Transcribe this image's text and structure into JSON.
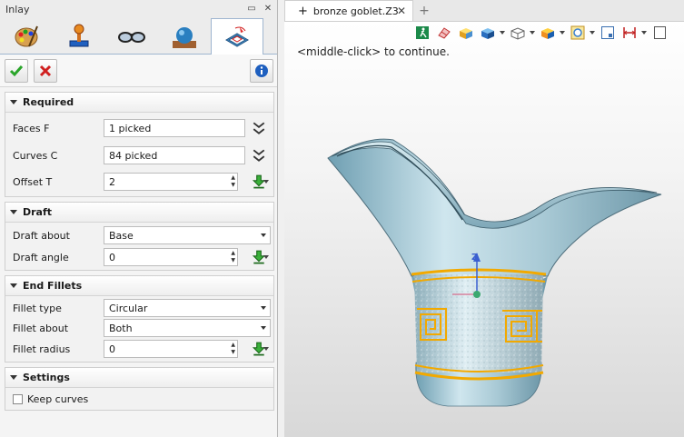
{
  "panel": {
    "title": "Inlay",
    "tabs": [
      {
        "icon": "paint-palette-icon"
      },
      {
        "icon": "joystick-icon"
      },
      {
        "icon": "glasses-icon"
      },
      {
        "icon": "sphere-icon"
      },
      {
        "icon": "inlay-tool-icon"
      }
    ]
  },
  "required": {
    "title": "Required",
    "faces_label": "Faces F",
    "faces_value": "1 picked",
    "curves_label": "Curves C",
    "curves_value": "84 picked",
    "offset_label": "Offset T",
    "offset_value": "2"
  },
  "draft": {
    "title": "Draft",
    "about_label": "Draft about",
    "about_value": "Base",
    "angle_label": "Draft angle",
    "angle_value": "0"
  },
  "fillets": {
    "title": "End Fillets",
    "type_label": "Fillet type",
    "type_value": "Circular",
    "about_label": "Fillet about",
    "about_value": "Both",
    "radius_label": "Fillet radius",
    "radius_value": "0"
  },
  "settings": {
    "title": "Settings",
    "keep_curves_label": "Keep curves"
  },
  "document": {
    "tab_label": "bronze goblet.Z3",
    "hint": "<middle-click> to continue."
  },
  "axis": {
    "z_label": "Z"
  },
  "colors": {
    "goblet": "#a9c9d6",
    "band": "#f2a900",
    "accept": "#2aa52a",
    "cancel": "#d02020",
    "info": "#1e5fbf"
  }
}
